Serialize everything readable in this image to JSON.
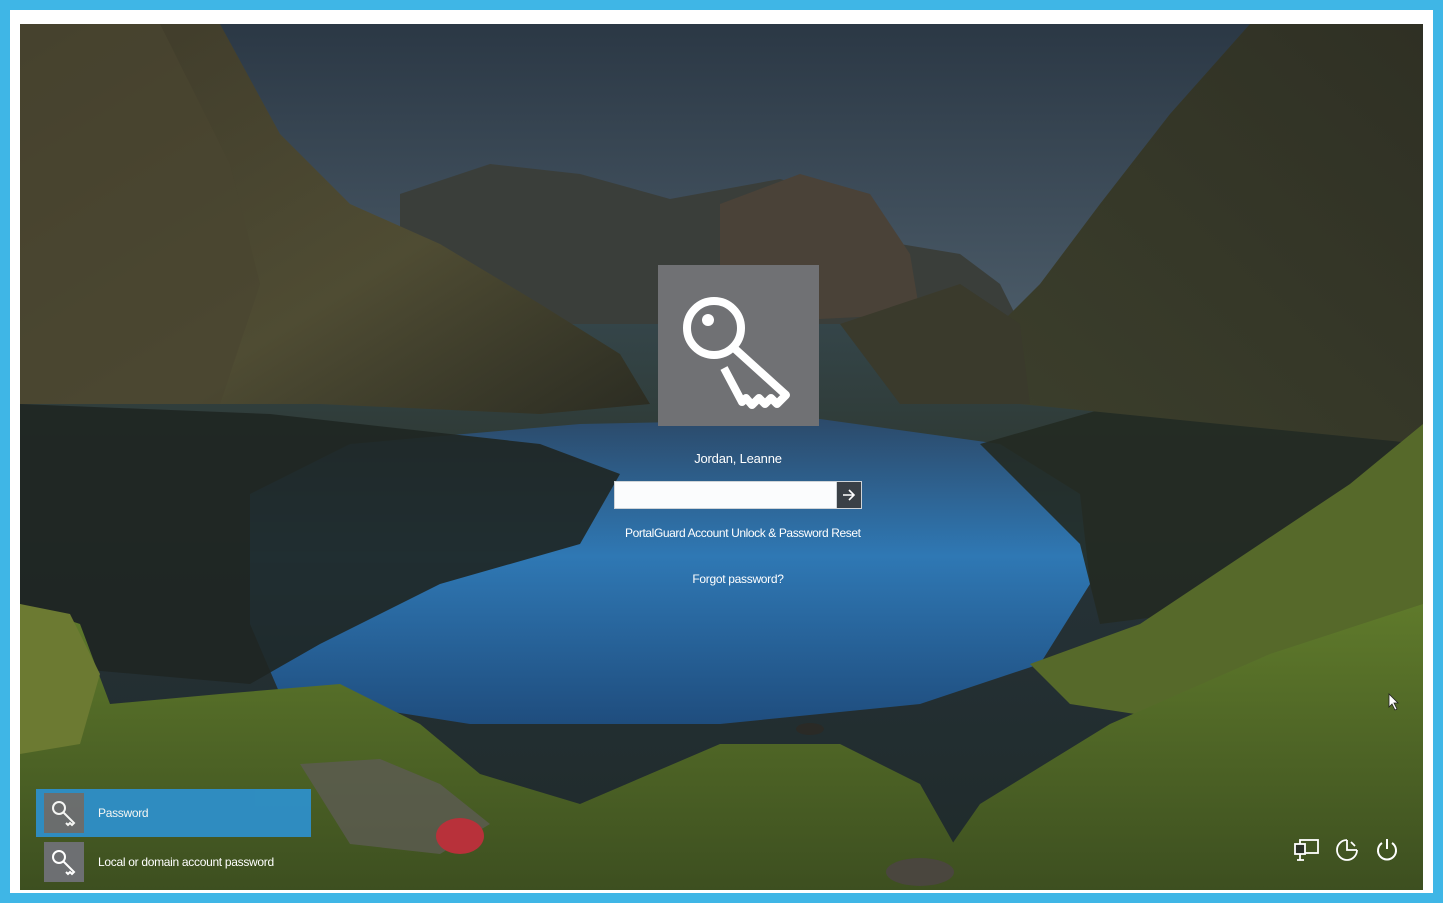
{
  "user": {
    "name": "Jordan, Leanne",
    "avatar_icon": "key-icon"
  },
  "signin": {
    "password_value": "",
    "password_placeholder": "",
    "submit_icon": "arrow-right-icon",
    "portalguard_link": "PortalGuard Account Unlock & Password Reset",
    "forgot_link": "Forgot password?"
  },
  "signin_options": [
    {
      "label": "Password",
      "icon": "key-icon",
      "selected": true
    },
    {
      "label": "Local or domain account password",
      "icon": "key-icon",
      "selected": false
    }
  ],
  "system_buttons": [
    {
      "name": "network-icon"
    },
    {
      "name": "ease-of-access-icon"
    },
    {
      "name": "power-icon"
    }
  ],
  "colors": {
    "frame": "#3fb6e6",
    "avatar_tile": "#707174",
    "selected_option": "#2e8fc9"
  }
}
